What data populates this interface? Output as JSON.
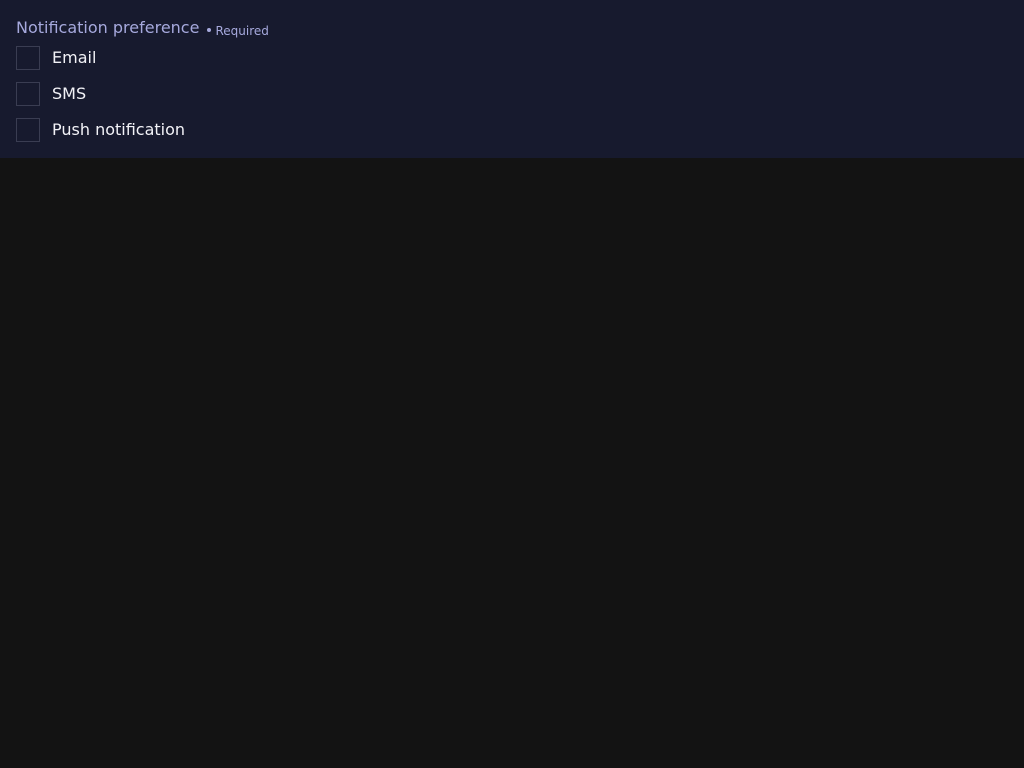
{
  "fieldset": {
    "legend": "Notification preference",
    "required_label": "Required",
    "options": [
      {
        "label": "Email",
        "checked": false
      },
      {
        "label": "SMS",
        "checked": false
      },
      {
        "label": "Push notification",
        "checked": false
      }
    ]
  },
  "colors": {
    "page_background": "#131313",
    "panel_background": "#171a2e",
    "legend_text": "#a6a9dd",
    "option_text": "#f2f2f7",
    "checkbox_border": "#3a3d52"
  }
}
